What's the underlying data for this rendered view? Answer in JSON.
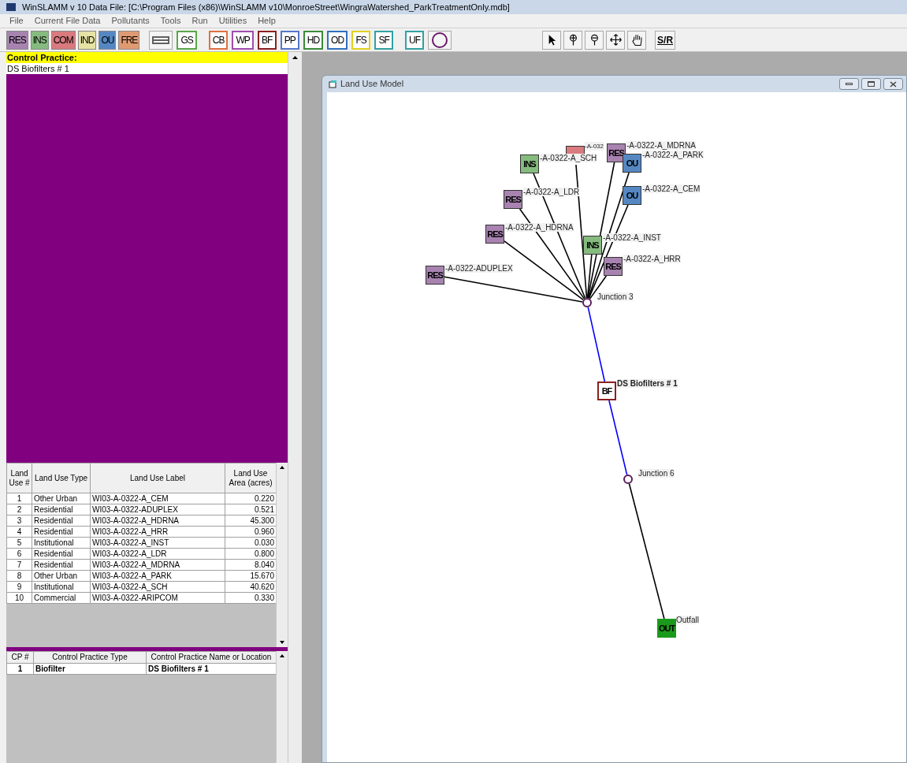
{
  "title_bar": {
    "title": "WinSLAMM v 10 Data File:   [C:\\Program Files (x86)\\WinSLAMM v10\\MonroeStreet\\WingraWatershed_ParkTreatmentOnly.mdb]"
  },
  "menu": [
    "File",
    "Current File Data",
    "Pollutants",
    "Tools",
    "Run",
    "Utilities",
    "Help"
  ],
  "toolbar": {
    "land_use_buttons": [
      {
        "label": "RES",
        "color": "#a883b0"
      },
      {
        "label": "INS",
        "color": "#86bb7f"
      },
      {
        "label": "COM",
        "color": "#d97a7e"
      },
      {
        "label": "IND",
        "color": "#e6e2a4"
      },
      {
        "label": "OU",
        "color": "#5588c2"
      },
      {
        "label": "FRE",
        "color": "#e09a72"
      }
    ],
    "practice_buttons": [
      {
        "kind": "lines",
        "color": "#606060"
      },
      {
        "kind": "text",
        "label": "GS",
        "color": "#5aa64a"
      },
      {
        "kind": "text",
        "label": "CB",
        "color": "#e07040"
      },
      {
        "kind": "text",
        "label": "WP",
        "color": "#a04cb0"
      },
      {
        "kind": "text",
        "label": "BF",
        "color": "#8b2020"
      },
      {
        "kind": "text",
        "label": "PP",
        "color": "#5577cc"
      },
      {
        "kind": "text",
        "label": "HD",
        "color": "#3a8a3a"
      },
      {
        "kind": "text",
        "label": "OD",
        "color": "#3070c0"
      },
      {
        "kind": "text",
        "label": "FS",
        "color": "#e0d020"
      },
      {
        "kind": "text",
        "label": "SF",
        "color": "#30a0a0"
      },
      {
        "kind": "text",
        "label": "UF",
        "color": "#30a0a0"
      },
      {
        "kind": "circle",
        "color": "#6a1a6a"
      }
    ],
    "tool_buttons": [
      {
        "kind": "pointer"
      },
      {
        "kind": "pin_plus"
      },
      {
        "kind": "pin_minus"
      },
      {
        "kind": "move"
      },
      {
        "kind": "hand"
      },
      {
        "kind": "text",
        "label": "S/R"
      }
    ]
  },
  "control_practice": {
    "heading": "Control Practice:",
    "value": "DS Biofilters # 1"
  },
  "land_use_table": {
    "columns": [
      "Land Use #",
      "Land Use Type",
      "Land Use Label",
      "Land Use Area (acres)"
    ],
    "rows": [
      [
        "1",
        "Other Urban",
        "WI03-A-0322-A_CEM",
        "0.220"
      ],
      [
        "2",
        "Residential",
        "WI03-A-0322-ADUPLEX",
        "0.521"
      ],
      [
        "3",
        "Residential",
        "WI03-A-0322-A_HDRNA",
        "45.300"
      ],
      [
        "4",
        "Residential",
        "WI03-A-0322-A_HRR",
        "0.960"
      ],
      [
        "5",
        "Institutional",
        "WI03-A-0322-A_INST",
        "0.030"
      ],
      [
        "6",
        "Residential",
        "WI03-A-0322-A_LDR",
        "0.800"
      ],
      [
        "7",
        "Residential",
        "WI03-A-0322-A_MDRNA",
        "8.040"
      ],
      [
        "8",
        "Other Urban",
        "WI03-A-0322-A_PARK",
        "15.670"
      ],
      [
        "9",
        "Institutional",
        "WI03-A-0322-A_SCH",
        "40.620"
      ],
      [
        "10",
        "Commercial",
        "WI03-A-0322-ARIPCOM",
        "0.330"
      ]
    ]
  },
  "cp_table": {
    "columns": [
      "CP #",
      "Control Practice Type",
      "Control Practice Name or Location"
    ],
    "rows": [
      [
        "1",
        "Biofilter",
        "DS Biofilters # 1"
      ]
    ]
  },
  "diagram_window": {
    "title": "Land Use Model",
    "nodes": [
      {
        "kind": "land_use",
        "label": "INS",
        "color": "#86bb7f",
        "caption": "-A-0322-A_SCH"
      },
      {
        "kind": "land_use",
        "color": "#d97a7e",
        "caption": "-A-032"
      },
      {
        "kind": "land_use",
        "label": "RES",
        "color": "#a883b0",
        "caption": "-A-0322-A_MDRNA"
      },
      {
        "kind": "land_use",
        "label": "OU",
        "color": "#5588c2",
        "caption": "-A-0322-A_PARK"
      },
      {
        "kind": "land_use",
        "label": "RES",
        "color": "#a883b0",
        "caption": "-A-0322-A_LDR"
      },
      {
        "kind": "land_use",
        "label": "OU",
        "color": "#5588c2",
        "caption": "-A-0322-A_CEM"
      },
      {
        "kind": "land_use",
        "label": "RES",
        "color": "#a883b0",
        "caption": "-A-0322-A_HDRNA"
      },
      {
        "kind": "land_use",
        "label": "INS",
        "color": "#86bb7f",
        "caption": "-A-0322-A_INST"
      },
      {
        "kind": "land_use",
        "label": "RES",
        "color": "#a883b0",
        "caption": "-A-0322-A_HRR"
      },
      {
        "kind": "land_use",
        "label": "RES",
        "color": "#a883b0",
        "caption": "-A-0322-ADUPLEX"
      },
      {
        "kind": "junction",
        "color": "#5a1a5a",
        "caption": "Junction 3"
      },
      {
        "kind": "control",
        "label": "BF",
        "color": "#8b2020",
        "caption": "DS Biofilters # 1"
      },
      {
        "kind": "junction",
        "color": "#5a1a5a",
        "caption": "Junction 6"
      },
      {
        "kind": "outfall",
        "label": "OUT",
        "color": "#1a9a1a",
        "caption": "Outfall"
      }
    ],
    "links": [
      {
        "color": "#000000"
      },
      {
        "color": "#000000"
      },
      {
        "color": "#000000"
      },
      {
        "color": "#000000"
      },
      {
        "color": "#000000"
      },
      {
        "color": "#000000"
      },
      {
        "color": "#000000"
      },
      {
        "color": "#000000"
      },
      {
        "color": "#000000"
      },
      {
        "color": "#000000"
      },
      {
        "color": "#0000ff"
      },
      {
        "color": "#0000ff"
      },
      {
        "color": "#000000"
      }
    ]
  }
}
